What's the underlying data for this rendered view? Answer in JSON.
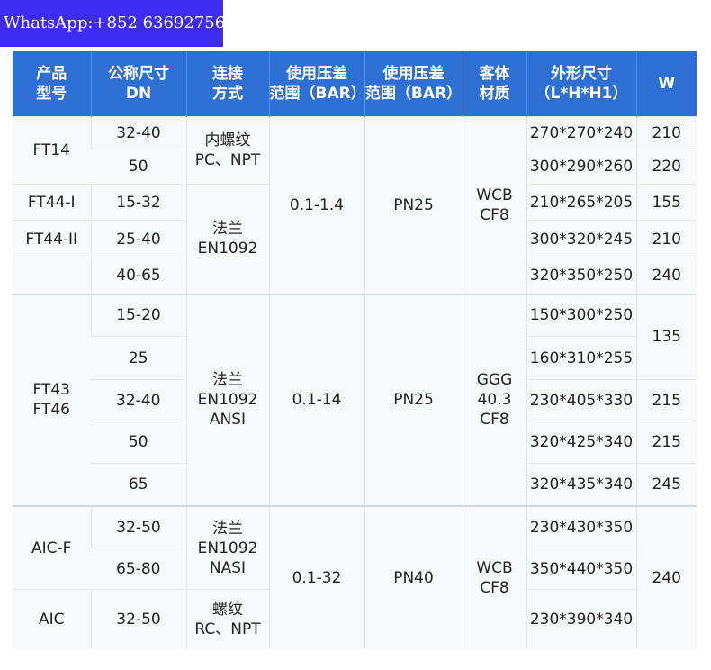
{
  "watermark": "WhatsApp:+852 63692756",
  "headers": {
    "model": "产品\n型号",
    "dn": "公称尺寸\nDN",
    "connection": "连接\n方式",
    "pressure_diff": "使用压差\n范围（BAR）",
    "pressure_range": "使用压差\n范围（BAR）",
    "body_material": "客体\n材质",
    "dimensions": "外形尺寸\n（L*H*H1）",
    "weight": "W"
  },
  "rows": [
    {
      "model": "FT14",
      "dn": "32-40",
      "connection": "内螺纹\nPC、NPT",
      "pressure_diff": "0.1-1.4",
      "pressure_range": "PN25",
      "body_material": "WCB\nCF8",
      "dimensions": "270*270*240",
      "weight": "210"
    },
    {
      "dn": "50",
      "dimensions": "300*290*260",
      "weight": "220"
    },
    {
      "model": "FT44-I",
      "dn": "15-32",
      "connection": "法兰\nEN1092",
      "dimensions": "210*265*205",
      "weight": "155"
    },
    {
      "model": "FT44-II",
      "dn": "25-40",
      "dimensions": "300*320*245",
      "weight": "210"
    },
    {
      "dn": "40-65",
      "dimensions": "320*350*250",
      "weight": "240"
    },
    {
      "model": "FT43\nFT46",
      "dn": "15-20",
      "connection": "法兰\nEN1092\nANSI",
      "pressure_diff": "0.1-14",
      "pressure_range": "PN25",
      "body_material": "GGG\n40.3\nCF8",
      "dimensions": "150*300*250",
      "weight": "135"
    },
    {
      "dn": "25",
      "dimensions": "160*310*255"
    },
    {
      "dn": "32-40",
      "dimensions": "230*405*330",
      "weight": "215"
    },
    {
      "dn": "50",
      "dimensions": "320*425*340",
      "weight": "215"
    },
    {
      "dn": "65",
      "dimensions": "320*435*340",
      "weight": "245"
    },
    {
      "model": "AIC-F",
      "dn": "32-50",
      "connection": "法兰\nEN1092\nNASI",
      "pressure_diff": "0.1-32",
      "pressure_range": "PN40",
      "body_material": "WCB\nCF8",
      "dimensions": "230*430*350",
      "weight": "240"
    },
    {
      "dn": "65-80",
      "dimensions": "350*440*350"
    },
    {
      "model": "AIC",
      "dn": "32-50",
      "connection": "螺纹\nRC、NPT",
      "dimensions": "230*390*340"
    }
  ],
  "colors": {
    "header_bg": "#2e6fd3",
    "header_text": "#ffffff",
    "cell_bg": "#f8f9fb",
    "watermark_bg": "#3d2bf0"
  }
}
